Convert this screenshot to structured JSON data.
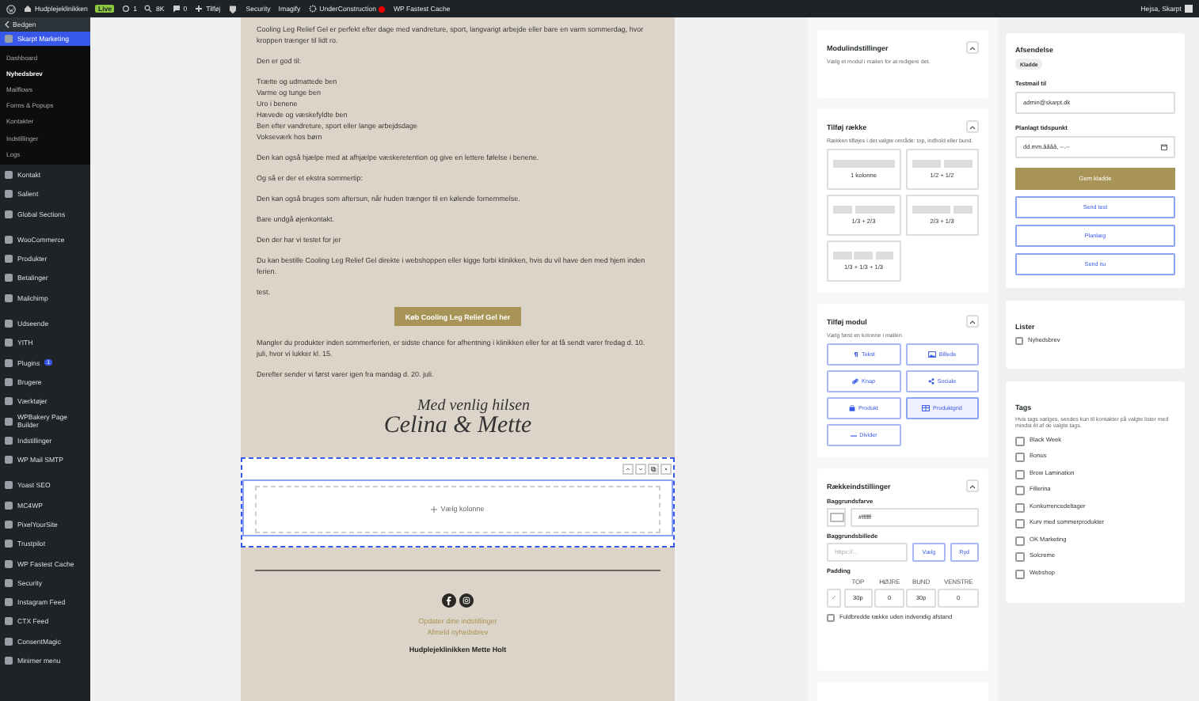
{
  "admin_bar": {
    "items": [
      {
        "kind": "logo"
      },
      {
        "kind": "site",
        "label": "Hudplejeklinikken"
      },
      {
        "kind": "badge",
        "label": "Live"
      },
      {
        "kind": "updates",
        "label": "1"
      },
      {
        "kind": "search",
        "label": "8K"
      },
      {
        "kind": "comments",
        "label": "0"
      },
      {
        "kind": "new",
        "label": "Tilføj"
      },
      {
        "kind": "plugin"
      },
      {
        "kind": "text",
        "label": "Security"
      },
      {
        "kind": "text",
        "label": "Imagify"
      },
      {
        "kind": "status",
        "label": "UnderConstruction"
      },
      {
        "kind": "text",
        "label": "WP Fastest Cache"
      }
    ],
    "greeting": "Hejsa, Skarpt"
  },
  "sidebar": {
    "back": "Bedgen",
    "groups": [
      [
        {
          "label": "Skarpt Marketing",
          "selected": true,
          "children": [
            {
              "label": "Dashboard",
              "selected": false
            },
            {
              "label": "Nyhedsbrev",
              "selected": true
            },
            {
              "label": "Mailflows",
              "selected": false
            },
            {
              "label": "Forms & Popups",
              "selected": false
            },
            {
              "label": "Kontakter",
              "selected": false
            },
            {
              "label": "Indstillinger",
              "selected": false
            },
            {
              "label": "Logs",
              "selected": false
            }
          ]
        },
        {
          "label": "Kontakt",
          "selected": false
        },
        {
          "label": "Salient",
          "selected": false
        },
        {
          "label": "Global Sections",
          "selected": false
        }
      ],
      [
        {
          "label": "WooCommerce",
          "selected": false
        },
        {
          "label": "Produkter",
          "selected": false
        },
        {
          "label": "Betalinger",
          "selected": false
        },
        {
          "label": "Mailchimp",
          "selected": false
        }
      ],
      [
        {
          "label": "Udseende",
          "selected": false
        },
        {
          "label": "YITH",
          "selected": false
        },
        {
          "label": "Plugins",
          "selected": false,
          "badge": "1"
        },
        {
          "label": "Brugere",
          "selected": false
        },
        {
          "label": "Værktøjer",
          "selected": false
        },
        {
          "label": "WPBakery Page Builder",
          "selected": false
        },
        {
          "label": "Indstillinger",
          "selected": false
        },
        {
          "label": "WP Mail SMTP",
          "selected": false
        }
      ],
      [
        {
          "label": "Yoast SEO",
          "selected": false
        },
        {
          "label": "MC4WP",
          "selected": false
        },
        {
          "label": "PixelYourSite",
          "selected": false
        },
        {
          "label": "Trustpilot",
          "selected": false
        },
        {
          "label": "WP Fastest Cache",
          "selected": false
        },
        {
          "label": "Security",
          "selected": false
        },
        {
          "label": "Instagram Feed",
          "selected": false
        },
        {
          "label": "CTX Feed",
          "selected": false
        },
        {
          "label": "ConsentMagic",
          "selected": false
        },
        {
          "label": "Minimer menu",
          "selected": false
        }
      ]
    ]
  },
  "email": {
    "blocks": [
      {
        "kind": "paragraph",
        "text": "Cooling Leg Relief Gel er perfekt efter dage med vandreture, sport, langvarigt arbejde eller bare en varm sommerdag, hvor kroppen trænger til lidt ro."
      },
      {
        "kind": "paragraph",
        "text": "Den er god til:"
      },
      {
        "kind": "list",
        "items": [
          "Trætte og udmattede ben",
          "Varme og tunge ben",
          "Uro i benene",
          "Hævede og væskefyldte ben",
          "Ben efter vandreture, sport eller lange arbejdsdage",
          "Vokseværk hos børn"
        ]
      },
      {
        "kind": "paragraph",
        "text": "Den kan også hjælpe med at afhjælpe væskeretention og give en lettere følelse i benene."
      },
      {
        "kind": "paragraph",
        "text": "Og så er der et ekstra sommertip:"
      },
      {
        "kind": "paragraph",
        "text": "Den kan også bruges som aftersun, når huden trænger til en kølende fornemmelse."
      },
      {
        "kind": "paragraph",
        "text": "Bare undgå øjenkontakt."
      },
      {
        "kind": "paragraph",
        "text": "Den der har vi testet for jer"
      },
      {
        "kind": "paragraph",
        "text": "Du kan bestille Cooling Leg Relief Gel direkte i webshoppen eller kigge forbi klinikken, hvis du vil have den med hjem inden ferien."
      },
      {
        "kind": "paragraph",
        "text": "test."
      },
      {
        "kind": "button",
        "label": "Køb Cooling Leg Relief Gel her"
      },
      {
        "kind": "paragraph",
        "text": "Mangler du produkter inden sommerferien, er sidste chance for afhentning i klinikken eller for at få sendt varer fredag d. 10. juli, hvor vi lukker kl. 15."
      },
      {
        "kind": "paragraph",
        "text": "Derefter sender vi først varer igen fra mandag d. 20. juli."
      },
      {
        "kind": "signature",
        "lines": [
          "Med venlig hilsen",
          "Celina & Mette"
        ]
      },
      {
        "kind": "empty_row",
        "label": "Vælg kolonne",
        "selected": true
      },
      {
        "kind": "divider"
      },
      {
        "kind": "social"
      },
      {
        "kind": "links",
        "items": [
          "Opdater dine indstillinger",
          "Afmeld nyhedsbrev"
        ]
      },
      {
        "kind": "footer",
        "text": "Hudplejeklinikken Mette Holt"
      }
    ]
  },
  "module_settings": {
    "title": "Modulindstillinger",
    "description": "Vælg et modul i mailen for at redigere det."
  },
  "add_row": {
    "title": "Tilføj række",
    "description": "Rækken tilføjes i det valgte område: top, indhold eller bund.",
    "layouts": [
      {
        "kind": "one",
        "label": "1 kolonne"
      },
      {
        "kind": "halves",
        "label": "1/2 + 1/2"
      },
      {
        "kind": "third_twothirds",
        "label": "1/3 + 2/3"
      },
      {
        "kind": "twothirds_third",
        "label": "2/3 + 1/3"
      },
      {
        "kind": "thirds",
        "label": "1/3 + 1/3 + 1/3"
      }
    ]
  },
  "add_module": {
    "title": "Tilføj modul",
    "description": "Vælg først en kolonne i mailen.",
    "modules": [
      {
        "kind": "text",
        "label": "Tekst",
        "selected": false
      },
      {
        "kind": "image",
        "label": "Billede",
        "selected": false
      },
      {
        "kind": "button",
        "label": "Knap",
        "selected": false
      },
      {
        "kind": "social",
        "label": "Sociale",
        "selected": false
      },
      {
        "kind": "product",
        "label": "Produkt",
        "selected": false
      },
      {
        "kind": "grid",
        "label": "Produktgrid",
        "selected": true
      },
      {
        "kind": "divider",
        "label": "Divider",
        "selected": false
      }
    ]
  },
  "row_settings": {
    "title": "Rækkeindstillinger",
    "background_color_label": "Baggrundsfarve",
    "background_color": "#ffffff",
    "background_image_label": "Baggrundsbillede",
    "background_image_placeholder": "https://...",
    "choose": "Vælg",
    "clear": "Ryd",
    "padding_label": "Padding",
    "padding": [
      {
        "label": "TOP",
        "value": "30p"
      },
      {
        "label": "HØJRE",
        "value": "0"
      },
      {
        "label": "BUND",
        "value": "30p"
      },
      {
        "label": "VENSTRE",
        "value": "0"
      }
    ],
    "full_width": {
      "label": "Fuldbredde række uden indvendig afstand",
      "checked": false
    }
  },
  "send": {
    "title": "Afsendelse",
    "status": "Kladde",
    "test_label": "Testmail til",
    "test_value": "admin@skarpt.dk",
    "schedule_label": "Planlagt tidspunkt",
    "schedule_value": "dd.mm.åååå, --.--",
    "save": "Gem kladde",
    "actions": [
      "Send test",
      "Planlæg",
      "Send nu"
    ]
  },
  "lists": {
    "title": "Lister",
    "items": [
      {
        "label": "Nyhedsbrev",
        "checked": false
      }
    ]
  },
  "tags": {
    "title": "Tags",
    "description": "Hvis tags vælges, sendes kun til kontakter på valgte lister med mindst ét af de valgte tags.",
    "items": [
      {
        "label": "Black Week",
        "checked": false
      },
      {
        "label": "Bonus",
        "checked": false
      },
      {
        "label": "Brow Lamination",
        "checked": false
      },
      {
        "label": "Fillerina",
        "checked": false
      },
      {
        "label": "Konkurrencedeltager",
        "checked": false
      },
      {
        "label": "Kurv med sommerprodukter",
        "checked": false
      },
      {
        "label": "OK Marketing",
        "checked": false
      },
      {
        "label": "Solcreme",
        "checked": false
      },
      {
        "label": "Webshop",
        "checked": false
      }
    ]
  }
}
